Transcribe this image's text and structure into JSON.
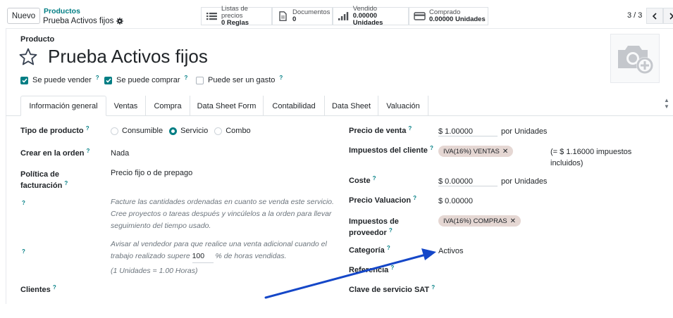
{
  "control_panel": {
    "new_button": "Nuevo",
    "breadcrumb_parent": "Productos",
    "breadcrumb_current": "Prueba Activos fijos",
    "pager": "3 / 3",
    "smart_buttons": [
      {
        "title": "Listas de precios",
        "value": "0 Reglas",
        "icon": "list-icon"
      },
      {
        "title": "Documentos",
        "value": "0",
        "icon": "document-icon"
      },
      {
        "title": "Vendido",
        "value": "0.00000 Unidades",
        "icon": "bar-chart-icon"
      },
      {
        "title": "Comprado",
        "value": "0.00000 Unidades",
        "icon": "credit-card-icon"
      }
    ]
  },
  "form": {
    "record_label": "Producto",
    "name": "Prueba Activos fijos",
    "checkboxes": [
      {
        "label": "Se puede vender",
        "checked": true,
        "help": "?"
      },
      {
        "label": "Se puede comprar",
        "checked": true,
        "help": "?"
      },
      {
        "label": "Puede ser un gasto",
        "checked": false,
        "help": "?"
      }
    ],
    "tabs": [
      "Información general",
      "Ventas",
      "Compra",
      "Data Sheet Form",
      "Contabilidad",
      "Data Sheet",
      "Valuación"
    ],
    "active_tab": "Información general",
    "left": {
      "tipo_producto_label": "Tipo de producto",
      "tipo_options": [
        "Consumible",
        "Servicio",
        "Combo"
      ],
      "tipo_selected": "Servicio",
      "crear_orden_label": "Crear en la orden",
      "crear_orden_value": "Nada",
      "politica_label_1": "Política de",
      "politica_label_2": "facturación",
      "politica_value": "Precio fijo o de prepago",
      "help_1_line_1": "Facture las cantidades ordenadas en cuanto se venda este servicio.",
      "help_1_line_2": "Cree proyectos o tareas después y vincúlelos a la orden para llevar",
      "help_1_line_3": "seguimiento del tiempo usado.",
      "help_2_line_1": "Avisar al vendedor para que realice una venta adicional cuando el",
      "help_2_line_2a": "trabajo realizado supere",
      "help_2_value": "100",
      "help_2_line_2b": "% de horas vendidas.",
      "help_2_line_3": "(1 Unidades = 1.00 Horas)",
      "clientes_label": "Clientes",
      "question_mark": "?"
    },
    "right": {
      "precio_venta_label": "Precio de venta",
      "precio_venta_value": "$ 1.00000",
      "precio_venta_uom": "por Unidades",
      "impuestos_cliente_label": "Impuestos del cliente",
      "impuestos_cliente_tag": "IVA(16%) VENTAS",
      "impuestos_incl_1": "(= $ 1.16000 impuestos",
      "impuestos_incl_2": "incluidos)",
      "coste_label": "Coste",
      "coste_value": "$ 0.00000",
      "coste_uom": "por Unidades",
      "precio_valuacion_label": "Precio Valuacion",
      "precio_valuacion_value": "$ 0.00000",
      "impuestos_prov_label_1": "Impuestos de",
      "impuestos_prov_label_2": "proveedor",
      "impuestos_prov_tag": "IVA(16%) COMPRAS",
      "categoria_label": "Categoría",
      "categoria_value": "Activos",
      "referencia_label": "Referencia",
      "clave_sat_label": "Clave de servicio SAT"
    }
  },
  "colors": {
    "accent": "#017e84",
    "tag_bg": "#e5d7d3",
    "annotation_arrow": "#1547c8"
  }
}
